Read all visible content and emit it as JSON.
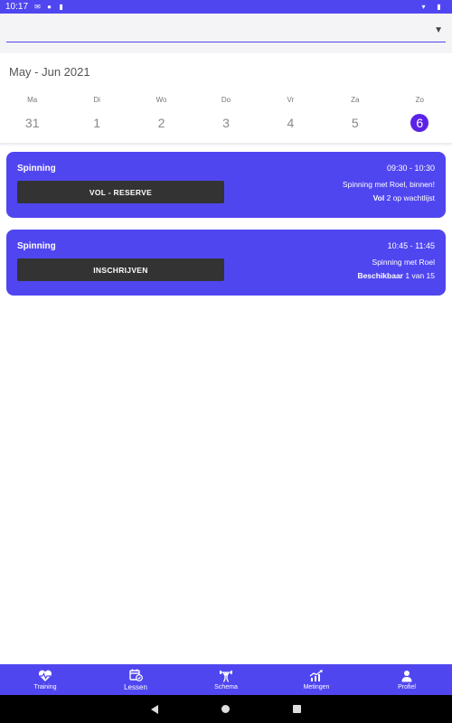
{
  "status_bar": {
    "time": "10:17"
  },
  "calendar": {
    "month_label": "May - Jun 2021",
    "days": [
      {
        "name": "Ma",
        "number": "31",
        "selected": false
      },
      {
        "name": "Di",
        "number": "1",
        "selected": false
      },
      {
        "name": "Wo",
        "number": "2",
        "selected": false
      },
      {
        "name": "Do",
        "number": "3",
        "selected": false
      },
      {
        "name": "Vr",
        "number": "4",
        "selected": false
      },
      {
        "name": "Za",
        "number": "5",
        "selected": false
      },
      {
        "name": "Zo",
        "number": "6",
        "selected": true
      }
    ]
  },
  "lessons": [
    {
      "title": "Spinning",
      "time": "09:30 - 10:30",
      "description": "Spinning met Roel, binnen!",
      "status_label": "Vol",
      "status_detail": "2 op wachtlijst",
      "button_label": "VOL - RESERVE"
    },
    {
      "title": "Spinning",
      "time": "10:45 - 11:45",
      "description": "Spinning met Roel",
      "status_label": "Beschikbaar",
      "status_detail": "1 van 15",
      "button_label": "INSCHRIJVEN"
    }
  ],
  "bottom_nav": [
    {
      "label": "Training",
      "icon": "heart-pulse-icon",
      "active": false
    },
    {
      "label": "Lessen",
      "icon": "calendar-check-icon",
      "active": true
    },
    {
      "label": "Schema",
      "icon": "weightlifter-icon",
      "active": false
    },
    {
      "label": "Metingen",
      "icon": "chart-up-icon",
      "active": false
    },
    {
      "label": "Profiel",
      "icon": "person-icon",
      "active": false
    }
  ],
  "colors": {
    "primary": "#5046f0",
    "selected_day": "#5a22e8",
    "button": "#333333"
  }
}
